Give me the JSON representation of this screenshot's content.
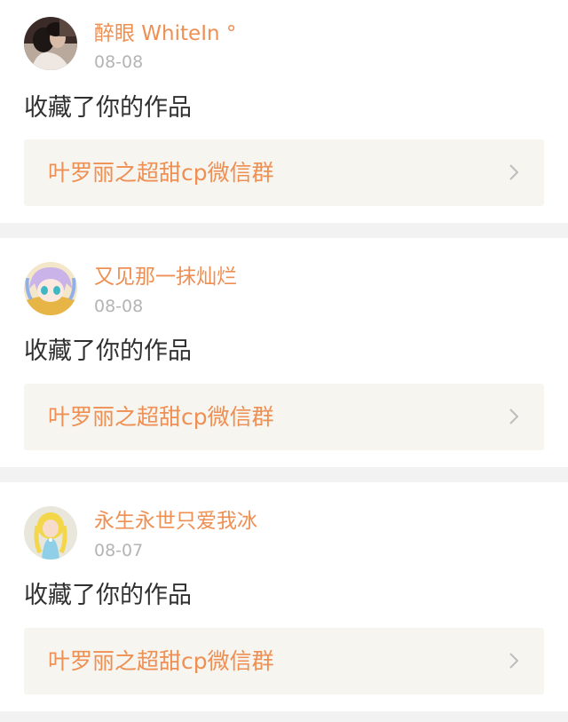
{
  "notifications": [
    {
      "user": "醉眼 WhiteIn °",
      "date": "08-08",
      "action": "收藏了你的作品",
      "work_title": "叶罗丽之超甜cp微信群",
      "avatar_icon": "user-avatar-photo"
    },
    {
      "user": "又见那一抹灿烂",
      "date": "08-08",
      "action": "收藏了你的作品",
      "work_title": "叶罗丽之超甜cp微信群",
      "avatar_icon": "user-avatar-anime"
    },
    {
      "user": "永生永世只爱我冰",
      "date": "08-07",
      "action": "收藏了你的作品",
      "work_title": "叶罗丽之超甜cp微信群",
      "avatar_icon": "user-avatar-doll"
    }
  ],
  "colors": {
    "accent": "#ee8f53",
    "timestamp": "#b4b4b4",
    "body_text": "#303030",
    "link_bg": "#f6f5f0",
    "page_bg": "#f2f2f2"
  }
}
